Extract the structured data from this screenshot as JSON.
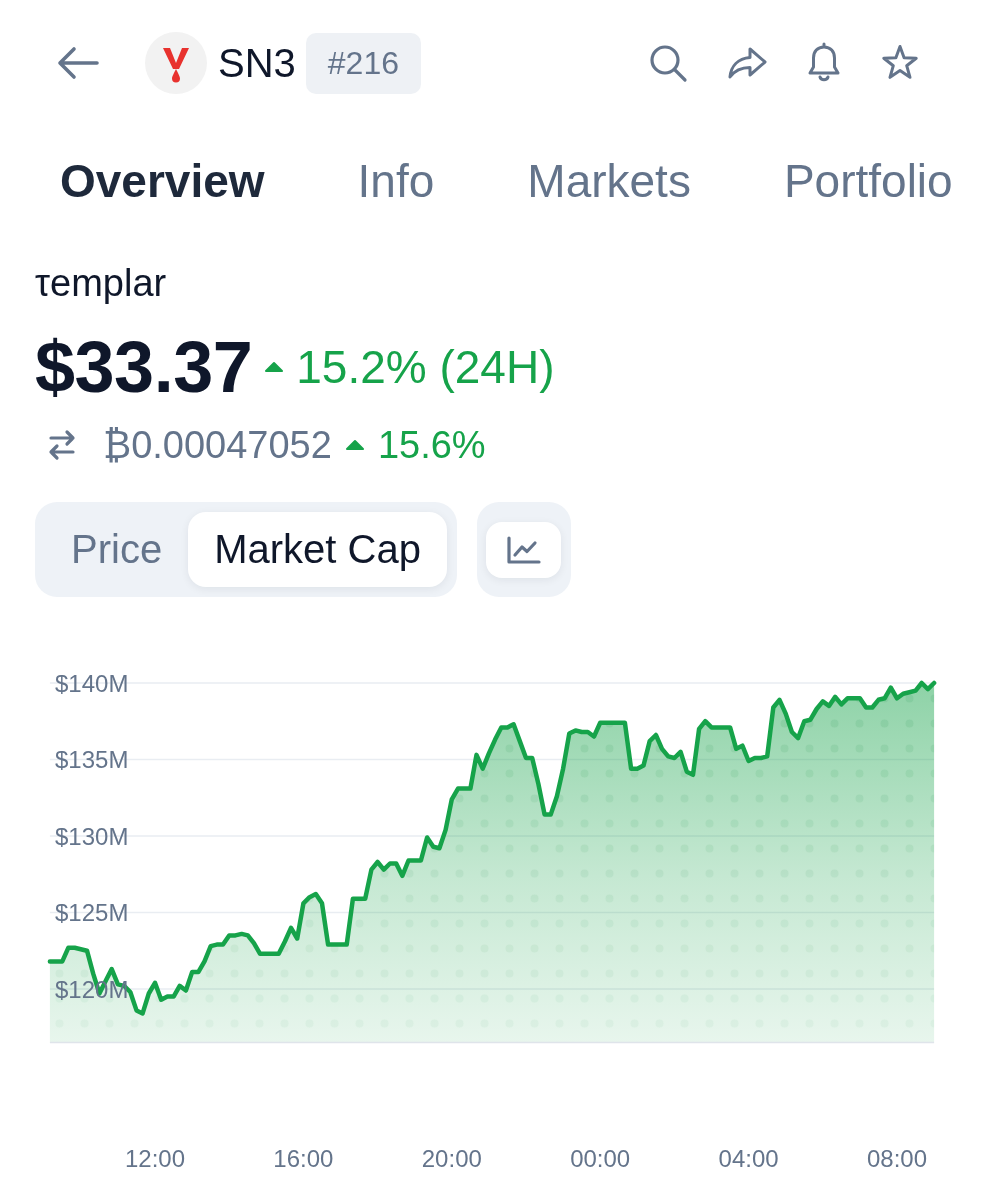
{
  "header": {
    "symbol": "SN3",
    "rank": "#216"
  },
  "tabs": [
    {
      "label": "Overview",
      "selected": true
    },
    {
      "label": "Info",
      "selected": false
    },
    {
      "label": "Markets",
      "selected": false
    },
    {
      "label": "Portfolio",
      "selected": false
    }
  ],
  "coin": {
    "name": "τemplar",
    "price": "$33.37",
    "change_24h": "15.2% (24H)",
    "change_24h_positive": true,
    "btc_price": "₿0.00047052",
    "btc_change": "15.6%",
    "btc_change_positive": true
  },
  "chart_toggle": [
    {
      "label": "Price",
      "selected": false
    },
    {
      "label": "Market Cap",
      "selected": true
    }
  ],
  "chart": {
    "chart_data": {
      "type": "area",
      "grid": true,
      "ylim": [
        116.5,
        140
      ],
      "yticks": [
        {
          "value": 120,
          "label": "$120M"
        },
        {
          "value": 125,
          "label": "$125M"
        },
        {
          "value": 130,
          "label": "$130M"
        },
        {
          "value": 135,
          "label": "$135M"
        },
        {
          "value": 140,
          "label": "$140M"
        }
      ],
      "categories": [
        null,
        null,
        null,
        null,
        null,
        null,
        null,
        null,
        null,
        null,
        null,
        null,
        null,
        null,
        null,
        null,
        null,
        "12:00",
        null,
        null,
        null,
        null,
        null,
        null,
        null,
        null,
        null,
        null,
        null,
        null,
        null,
        null,
        null,
        null,
        null,
        null,
        null,
        null,
        null,
        null,
        null,
        "16:00",
        null,
        null,
        null,
        null,
        null,
        null,
        null,
        null,
        null,
        null,
        null,
        null,
        null,
        null,
        null,
        null,
        null,
        null,
        null,
        null,
        null,
        null,
        null,
        "20:00",
        null,
        null,
        null,
        null,
        null,
        null,
        null,
        null,
        null,
        null,
        null,
        null,
        null,
        null,
        null,
        null,
        null,
        null,
        null,
        null,
        null,
        null,
        null,
        "00:00",
        null,
        null,
        null,
        null,
        null,
        null,
        null,
        null,
        null,
        null,
        null,
        null,
        null,
        null,
        null,
        null,
        null,
        null,
        null,
        null,
        null,
        null,
        null,
        "04:00",
        null,
        null,
        null,
        null,
        null,
        null,
        null,
        null,
        null,
        null,
        null,
        null,
        null,
        null,
        null,
        null,
        null,
        null,
        null,
        null,
        null,
        null,
        null,
        "08:00",
        null,
        null,
        null,
        null,
        null,
        null
      ],
      "values": [
        121.8,
        121.8,
        121.8,
        122.7,
        122.7,
        122.6,
        122.5,
        121.0,
        119.7,
        120.5,
        121.3,
        120.3,
        120.2,
        119.8,
        118.6,
        118.4,
        119.7,
        120.4,
        119.3,
        119.5,
        119.5,
        120.2,
        119.9,
        121.1,
        121.1,
        121.8,
        122.8,
        122.9,
        122.9,
        123.5,
        123.5,
        123.6,
        123.5,
        123.0,
        122.3,
        122.3,
        122.3,
        122.3,
        123.1,
        124.0,
        123.3,
        125.6,
        126.0,
        126.2,
        125.6,
        122.9,
        122.9,
        122.9,
        122.9,
        125.9,
        125.9,
        125.9,
        127.8,
        128.3,
        127.8,
        128.2,
        128.2,
        127.4,
        128.4,
        128.4,
        128.4,
        129.9,
        129.3,
        129.2,
        130.4,
        132.4,
        133.1,
        133.1,
        133.1,
        135.3,
        134.4,
        135.4,
        136.3,
        137.1,
        137.1,
        137.3,
        136.2,
        135.1,
        135.1,
        133.4,
        131.4,
        131.4,
        132.6,
        134.4,
        136.7,
        136.9,
        136.8,
        136.8,
        136.5,
        137.4,
        137.4,
        137.4,
        137.4,
        137.4,
        134.4,
        134.4,
        134.6,
        136.2,
        136.6,
        135.7,
        135.2,
        135.1,
        135.5,
        134.2,
        134.0,
        137.0,
        137.5,
        137.1,
        137.1,
        137.1,
        137.1,
        135.7,
        135.9,
        134.9,
        135.1,
        135.1,
        135.2,
        138.4,
        138.9,
        138.0,
        136.8,
        136.4,
        137.5,
        137.6,
        138.3,
        138.8,
        138.5,
        139.1,
        138.6,
        139.0,
        139.0,
        139.0,
        138.4,
        138.4,
        138.9,
        139.0,
        139.7,
        139.0,
        139.3,
        139.4,
        139.5,
        140.0,
        139.6,
        140.0
      ]
    }
  }
}
